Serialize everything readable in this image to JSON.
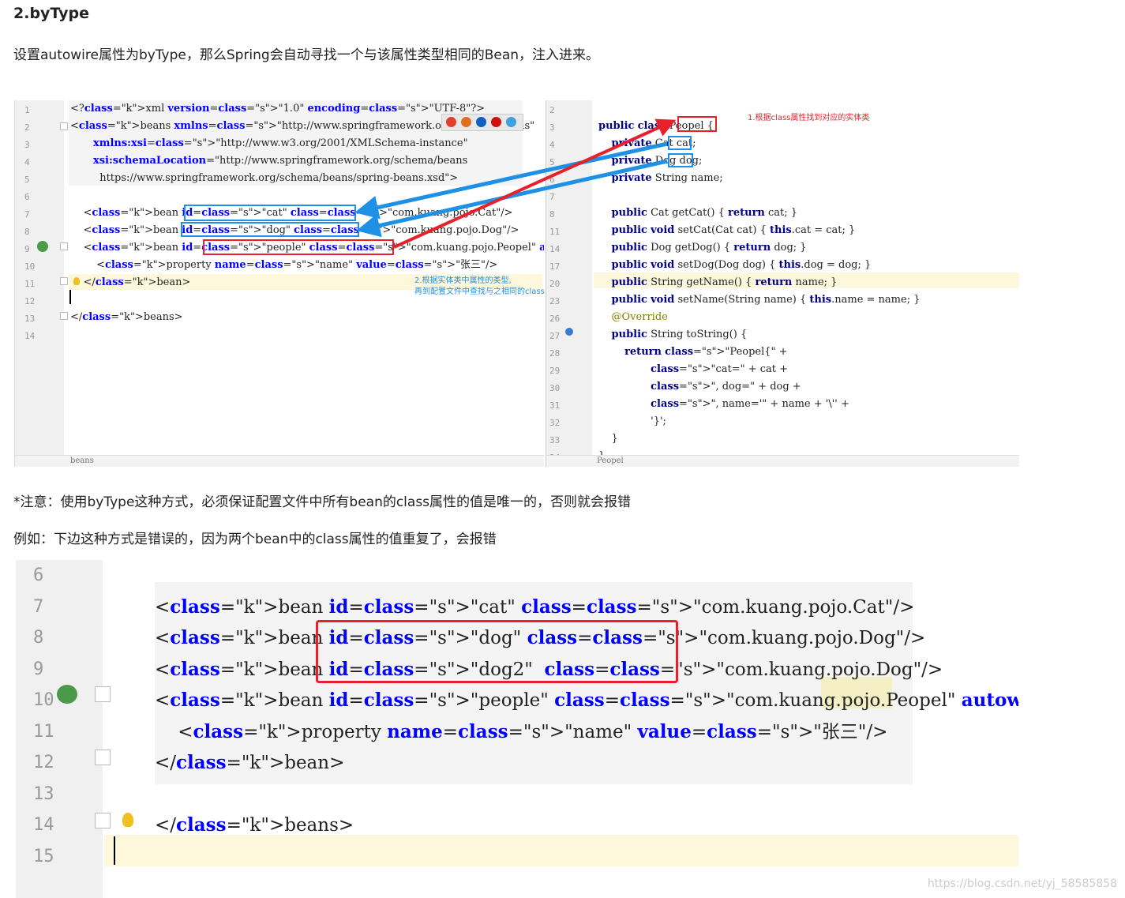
{
  "heading": "2.byType",
  "intro": "设置autowire属性为byType，那么Spring会自动寻找一个与该属性类型相同的Bean，注入进来。",
  "screen1": {
    "left_tab": "beans",
    "right_tab": "Peopel",
    "xml_line_numbers": [
      "1",
      "2",
      "3",
      "4",
      "5",
      "6",
      "7",
      "8",
      "9",
      "10",
      "11",
      "12",
      "13",
      "14"
    ],
    "xml_lines": [
      "<?xml version=\"1.0\" encoding=\"UTF-8\"?>",
      "<beans xmlns=\"http://www.springframework.org/schema/beans\"",
      "       xmlns:xsi=\"http://www.w3.org/2001/XMLSchema-instance\"",
      "       xsi:schemaLocation=\"http://www.springframework.org/schema/beans",
      "         https://www.springframework.org/schema/beans/spring-beans.xsd\">",
      "",
      "    <bean id=\"cat\" class=\"com.kuang.pojo.Cat\"/>",
      "    <bean id=\"dog\" class=\"com.kuang.pojo.Dog\"/>",
      "    <bean id=\"people\" class=\"com.kuang.pojo.Peopel\" autowire=\"byType\">",
      "        <property name=\"name\" value=\"张三\"/>",
      "    </bean>",
      "",
      "</beans>",
      ""
    ],
    "java_line_numbers": [
      "2",
      "3",
      "4",
      "5",
      "6",
      "7",
      "8",
      "11",
      "14",
      "17",
      "20",
      "23",
      "26",
      "27",
      "28",
      "29",
      "30",
      "31",
      "32",
      "33",
      "34"
    ],
    "java_lines": [
      "",
      "public class Peopel {",
      "    private Cat cat;",
      "    private Dog dog;",
      "    private String name;",
      "",
      "    public Cat getCat() { return cat; }",
      "    public void setCat(Cat cat) { this.cat = cat; }",
      "    public Dog getDog() { return dog; }",
      "    public void setDog(Dog dog) { this.dog = dog; }",
      "    public String getName() { return name; }",
      "    public void setName(String name) { this.name = name; }",
      "    @Override",
      "    public String toString() {",
      "        return \"Peopel{\" +",
      "                \"cat=\" + cat +",
      "                \", dog=\" + dog +",
      "                \", name='\" + name + '\\'' +",
      "                '}';",
      "    }",
      "}"
    ],
    "note1": "1.根据class属性找到对应的实体类",
    "note2_line1": "2.根据实体类中属性的类型,",
    "note2_line2": "再到配置文件中查找与之相同的class"
  },
  "notice": "*注意：使用byType这种方式，必须保证配置文件中所有bean的class属性的值是唯一的，否则就会报错",
  "example": "例如：下边这种方式是错误的，因为两个bean中的class属性的值重复了，会报错",
  "screen2": {
    "line_numbers": [
      "6",
      "7",
      "8",
      "9",
      "10",
      "11",
      "12",
      "13",
      "14",
      "15"
    ],
    "lines": [
      "",
      "<bean id=\"cat\" class=\"com.kuang.pojo.Cat\"/>",
      "<bean id=\"dog\" class=\"com.kuang.pojo.Dog\"/>",
      "<bean id=\"dog2\"  class=\"com.kuang.pojo.Dog\"/>",
      "<bean id=\"people\" class=\"com.kuang.pojo.Peopel\" autowire=\"byType\">",
      "    <property name=\"name\" value=\"张三\"/>",
      "</bean>",
      "",
      "</beans>",
      ""
    ]
  },
  "watermark": "https://blog.csdn.net/yj_58585858",
  "colors": {
    "red": "#e8202a",
    "blue": "#1e90e6",
    "highlight": "#fdf8dc"
  }
}
